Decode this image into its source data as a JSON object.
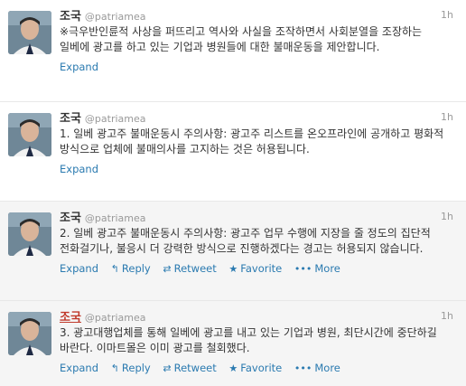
{
  "tweets": [
    {
      "fullname": "조국",
      "username": "@patriamea",
      "time": "1h",
      "text": "※극우반인륜적 사상을 퍼뜨리고 역사와 사실을 조작하면서 사회분열을 조장하는 일베에 광고를 하고 있는 기업과 병원들에 대한 불매운동을 제안합니다.",
      "expand": "Expand"
    },
    {
      "fullname": "조국",
      "username": "@patriamea",
      "time": "1h",
      "text": "1. 일베 광고주 불매운동시 주의사항: 광고주 리스트를 온오프라인에 공개하고 평화적 방식으로 업체에 불매의사를 고지하는 것은 허용됩니다.",
      "expand": "Expand"
    },
    {
      "fullname": "조국",
      "username": "@patriamea",
      "time": "1h",
      "text": "2. 일베 광고주 불매운동시 주의사항: 광고주 업무 수행에 지장을 줄 정도의 집단적 전화걸기나, 불응시 더 강력한 방식으로 진행하겠다는 경고는 허용되지 않습니다.",
      "expand": "Expand",
      "reply": "Reply",
      "retweet": "Retweet",
      "favorite": "Favorite",
      "more": "More"
    },
    {
      "fullname": "조국",
      "username": "@patriamea",
      "time": "1h",
      "text": "3. 광고대행업체를 통해 일베에 광고를 내고 있는 기업과 병원, 최단시간에 중단하길 바란다. 이마트몰은 이미 광고를 철회했다.",
      "expand": "Expand",
      "reply": "Reply",
      "retweet": "Retweet",
      "favorite": "Favorite",
      "more": "More"
    }
  ],
  "icons": {
    "reply": "reply-arrow-icon",
    "retweet": "retweet-icon",
    "favorite": "star-icon",
    "more": "more-dots-icon"
  },
  "colors": {
    "link": "#2a7ab0",
    "muted": "#999999",
    "text": "#333333",
    "hover_bg": "#f5f5f5",
    "name_highlight": "#c0392b"
  }
}
